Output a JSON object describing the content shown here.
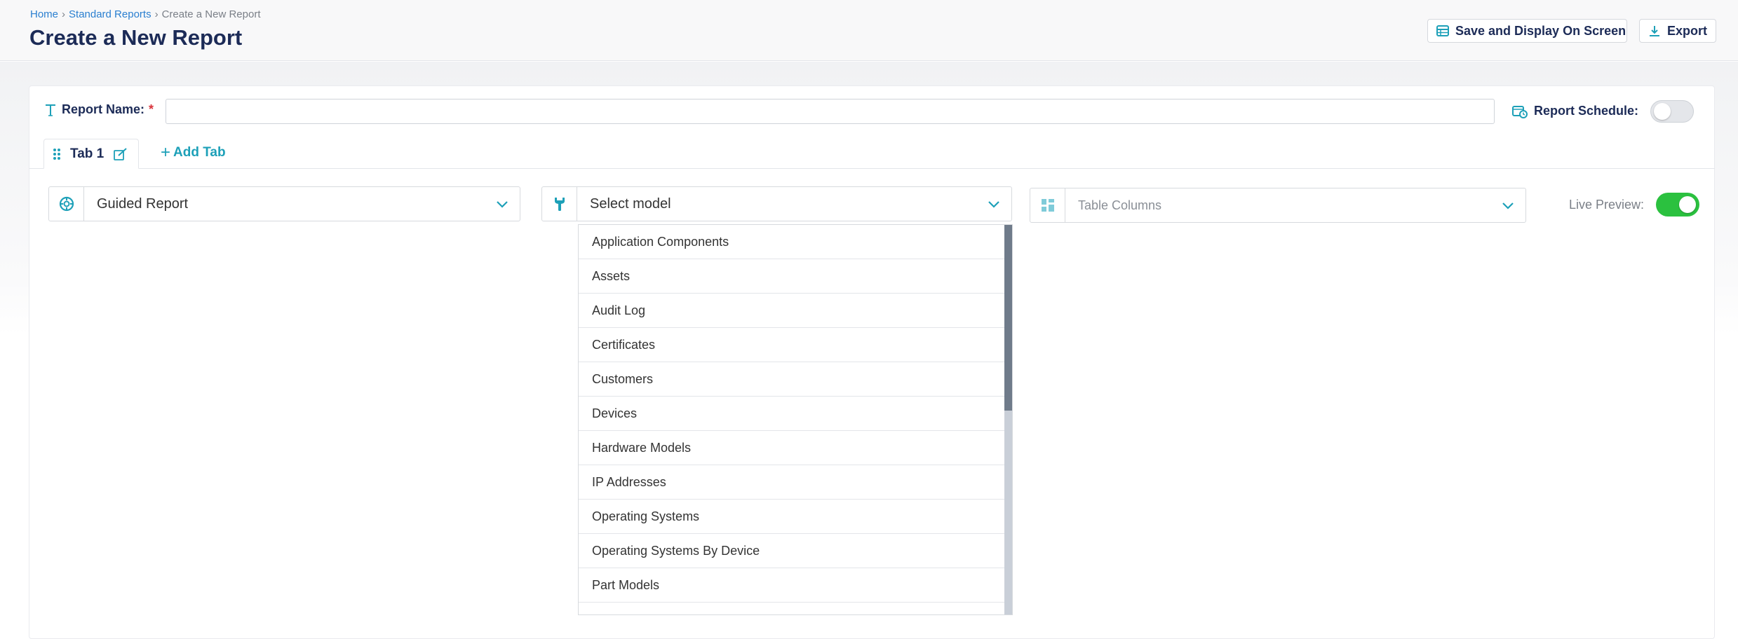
{
  "breadcrumb": {
    "home": "Home",
    "standard_reports": "Standard Reports",
    "current": "Create a New Report",
    "separator": "›"
  },
  "page": {
    "title": "Create a New Report"
  },
  "header_actions": {
    "save_display": "Save and Display On Screen",
    "export": "Export"
  },
  "form": {
    "report_name_label": "Report Name:",
    "required_mark": "*",
    "report_name_value": "",
    "report_schedule_label": "Report Schedule:",
    "report_schedule_on": false
  },
  "tabs": {
    "items": [
      {
        "label": "Tab 1",
        "active": true
      }
    ],
    "add_tab_label": "Add Tab"
  },
  "selectors": {
    "report_type": "Guided Report",
    "model_placeholder": "Select model",
    "table_columns_placeholder": "Table Columns"
  },
  "live_preview": {
    "label": "Live Preview:",
    "on": true
  },
  "model_dropdown": {
    "options": [
      "Application Components",
      "Assets",
      "Audit Log",
      "Certificates",
      "Customers",
      "Devices",
      "Hardware Models",
      "IP Addresses",
      "Operating Systems",
      "Operating Systems By Device",
      "Part Models",
      ""
    ]
  },
  "colors": {
    "brand_navy": "#1c2b57",
    "accent_teal": "#1da0b8",
    "link_blue": "#2a7fd0",
    "toggle_on": "#2bc13f",
    "required_red": "#d9343c"
  },
  "icons": {
    "save": "table-icon",
    "export": "download-icon",
    "report_name": "text-type-icon",
    "report_schedule": "calendar-clock-icon",
    "tab_drag": "drag-handle-icon",
    "tab_edit": "edit-icon",
    "guided": "compass-icon",
    "model": "wrench-icon",
    "columns": "columns-layout-icon",
    "chevron": "chevron-down-icon"
  }
}
